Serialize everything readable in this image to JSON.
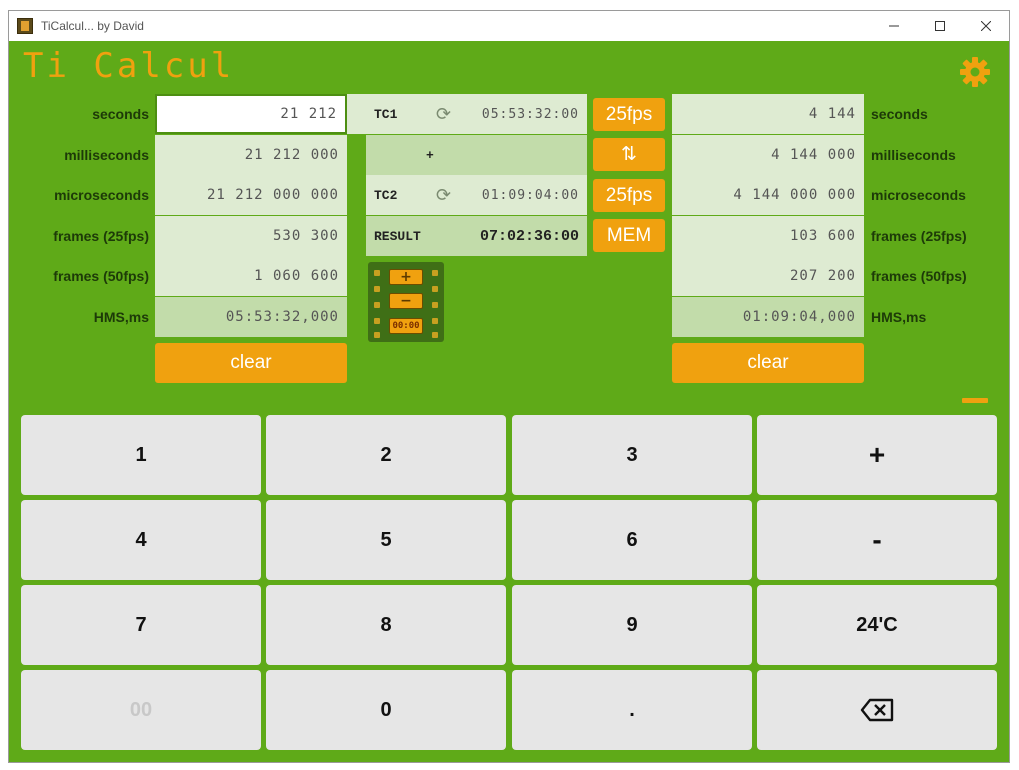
{
  "window": {
    "title": "TiCalcul... by David",
    "controls": [
      "minimize",
      "maximize",
      "close"
    ]
  },
  "app": {
    "title": "Ti Calcul",
    "settings_icon": "gear-icon"
  },
  "left_converter": {
    "rows": [
      {
        "label": "seconds",
        "value": "21 212"
      },
      {
        "label": "milliseconds",
        "value": "21 212 000"
      },
      {
        "label": "microseconds",
        "value": "21 212 000 000"
      },
      {
        "label": "frames (25fps)",
        "value": "530 300"
      },
      {
        "label": "frames (50fps)",
        "value": "1 060 600"
      },
      {
        "label": "HMS,ms",
        "value": "05:53:32,000"
      }
    ],
    "clear_label": "clear"
  },
  "right_converter": {
    "rows": [
      {
        "label": "seconds",
        "value": "4 144"
      },
      {
        "label": "milliseconds",
        "value": "4 144 000"
      },
      {
        "label": "microseconds",
        "value": "4 144 000 000"
      },
      {
        "label": "frames (25fps)",
        "value": "103 600"
      },
      {
        "label": "frames (50fps)",
        "value": "207 200"
      },
      {
        "label": "HMS,ms",
        "value": "01:09:04,000"
      }
    ],
    "clear_label": "clear"
  },
  "timecode": {
    "tc1_label": "TC1",
    "tc1_value": "05:53:32:00",
    "operator": "+",
    "tc2_label": "TC2",
    "tc2_value": "01:09:04:00",
    "result_label": "RESULT",
    "result_value": "07:02:36:00",
    "fps1": "25fps",
    "swap": "⇅",
    "fps2": "25fps",
    "mem": "MEM",
    "film_buttons": [
      "+",
      "−",
      "00:00"
    ]
  },
  "keypad": {
    "keys": [
      "1",
      "2",
      "3",
      "+",
      "4",
      "5",
      "6",
      "-",
      "7",
      "8",
      "9",
      "24'C",
      "00",
      "0",
      ".",
      "⌫"
    ]
  },
  "colors": {
    "background": "#5faa18",
    "accent": "#f0a10f",
    "field": "#deebd2",
    "field_dark": "#c2dcaa",
    "key": "#e6e6e6"
  }
}
